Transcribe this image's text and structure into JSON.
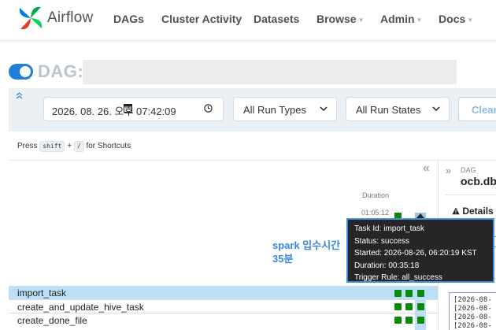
{
  "navbar": {
    "brand": "Airflow",
    "items": [
      {
        "label": "DAGs",
        "dropdown": false
      },
      {
        "label": "Cluster Activity",
        "dropdown": false
      },
      {
        "label": "Datasets",
        "dropdown": false
      },
      {
        "label": "Browse",
        "dropdown": true
      },
      {
        "label": "Admin",
        "dropdown": true
      },
      {
        "label": "Docs",
        "dropdown": true
      }
    ],
    "caret": "▼"
  },
  "dag_header": {
    "label": "DAG:",
    "toggle_on": true
  },
  "filters": {
    "date_value": "2026. 08. 26.    오후 07:42:09",
    "run_types": "All Run Types",
    "run_states": "All Run States",
    "clear_label": "Clear"
  },
  "shortcuts": {
    "press": "Press",
    "key1": "shift",
    "plus": "+",
    "key2": "/",
    "suffix": "for Shortcuts"
  },
  "grid": {
    "collapse_icon": "«",
    "duration_label": "Duration",
    "duration_value": "01:05:12",
    "tasks": [
      {
        "name": "import_task",
        "selected": true
      },
      {
        "name": "create_and_update_hive_task",
        "selected": false
      },
      {
        "name": "create_done_file",
        "selected": false
      }
    ]
  },
  "annotation": {
    "line1": "spark 입수시간",
    "line2": "35분"
  },
  "tooltip": {
    "task_id": "Task Id: import_task",
    "status": "Status: success",
    "started": "Started: 2026-08-26, 06:20:19 KST",
    "duration": "Duration: 00:35:18",
    "trigger_rule": "Trigger Rule: all_success"
  },
  "right_panel": {
    "collapse_icon": "»",
    "dag_label": "DAG",
    "dag_name": "ocb.db",
    "details_label": "Details",
    "logs": [
      "[2026-08-",
      "[2026-08-",
      "[2026-08-",
      "[2026-08-"
    ]
  },
  "colors": {
    "success": "#0a8a0a",
    "accent": "#1f7ed6",
    "selected_row": "#bcdff6",
    "tooltip_bg": "#262626",
    "annotation": "#3a86df"
  }
}
